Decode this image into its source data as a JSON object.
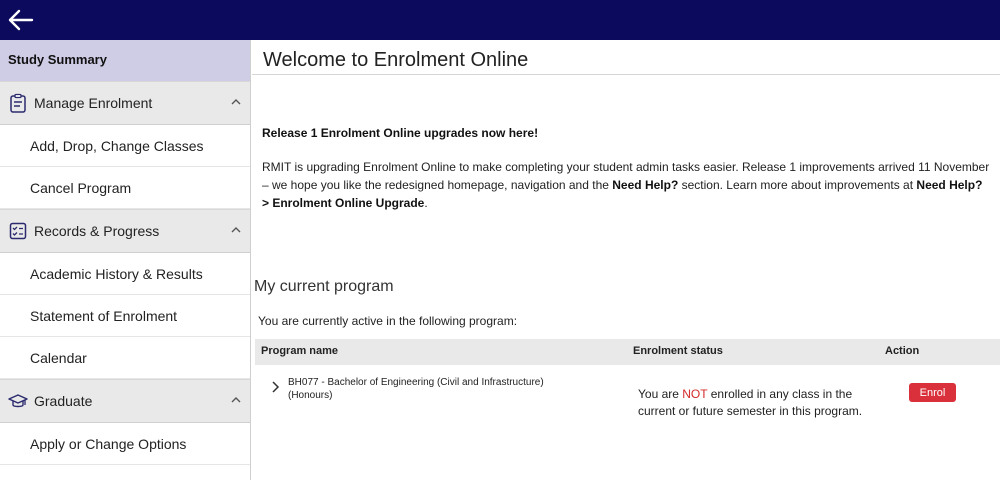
{
  "topbar": {
    "back_icon": "arrow-left-icon",
    "color": "#0b0a5c"
  },
  "sidebar": {
    "study_summary": "Study Summary",
    "sections": [
      {
        "label": "Manage Enrolment",
        "icon": "clipboard-icon",
        "items": [
          "Add, Drop, Change Classes",
          "Cancel Program"
        ]
      },
      {
        "label": "Records & Progress",
        "icon": "checklist-icon",
        "items": [
          "Academic History & Results",
          "Statement of Enrolment",
          "Calendar"
        ]
      },
      {
        "label": "Graduate",
        "icon": "graduation-cap-icon",
        "items": [
          "Apply or Change Options"
        ]
      }
    ]
  },
  "main": {
    "title": "Welcome to Enrolment Online",
    "notice": {
      "heading": "Release 1 Enrolment Online upgrades now here!",
      "text1": "RMIT is upgrading Enrolment Online to make completing your student admin tasks easier. Release 1 improvements arrived 11 November",
      "text2": "– we hope you like the redesigned homepage, navigation and the ",
      "need_help": "Need Help?",
      "text3": " section. Learn more about improvements at ",
      "need_help2": "Need Help?",
      "link": "> Enrolment Online Upgrade",
      "end": "."
    },
    "program": {
      "heading": "My current program",
      "subtext": "You are currently active in the following program:",
      "columns": {
        "name": "Program name",
        "status": "Enrolment status",
        "action": "Action"
      },
      "row": {
        "name": "BH077 - Bachelor of Engineering (Civil and Infrastructure) (Honours)",
        "status_pre": "You are ",
        "status_not": "NOT",
        "status_post": " enrolled in any class in the current or future semester in this program.",
        "action_label": "Enrol"
      }
    }
  }
}
